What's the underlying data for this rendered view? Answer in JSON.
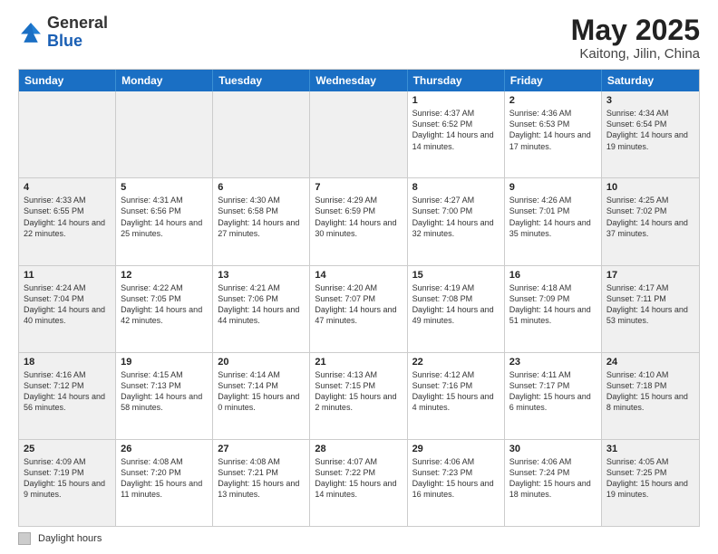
{
  "header": {
    "logo_general": "General",
    "logo_blue": "Blue",
    "title": "May 2025",
    "subtitle": "Kaitong, Jilin, China"
  },
  "calendar": {
    "days_of_week": [
      "Sunday",
      "Monday",
      "Tuesday",
      "Wednesday",
      "Thursday",
      "Friday",
      "Saturday"
    ],
    "rows": [
      [
        {
          "day": "",
          "text": "",
          "shaded": true
        },
        {
          "day": "",
          "text": "",
          "shaded": true
        },
        {
          "day": "",
          "text": "",
          "shaded": true
        },
        {
          "day": "",
          "text": "",
          "shaded": true
        },
        {
          "day": "1",
          "text": "Sunrise: 4:37 AM\nSunset: 6:52 PM\nDaylight: 14 hours and 14 minutes.",
          "shaded": false
        },
        {
          "day": "2",
          "text": "Sunrise: 4:36 AM\nSunset: 6:53 PM\nDaylight: 14 hours and 17 minutes.",
          "shaded": false
        },
        {
          "day": "3",
          "text": "Sunrise: 4:34 AM\nSunset: 6:54 PM\nDaylight: 14 hours and 19 minutes.",
          "shaded": true
        }
      ],
      [
        {
          "day": "4",
          "text": "Sunrise: 4:33 AM\nSunset: 6:55 PM\nDaylight: 14 hours and 22 minutes.",
          "shaded": true
        },
        {
          "day": "5",
          "text": "Sunrise: 4:31 AM\nSunset: 6:56 PM\nDaylight: 14 hours and 25 minutes.",
          "shaded": false
        },
        {
          "day": "6",
          "text": "Sunrise: 4:30 AM\nSunset: 6:58 PM\nDaylight: 14 hours and 27 minutes.",
          "shaded": false
        },
        {
          "day": "7",
          "text": "Sunrise: 4:29 AM\nSunset: 6:59 PM\nDaylight: 14 hours and 30 minutes.",
          "shaded": false
        },
        {
          "day": "8",
          "text": "Sunrise: 4:27 AM\nSunset: 7:00 PM\nDaylight: 14 hours and 32 minutes.",
          "shaded": false
        },
        {
          "day": "9",
          "text": "Sunrise: 4:26 AM\nSunset: 7:01 PM\nDaylight: 14 hours and 35 minutes.",
          "shaded": false
        },
        {
          "day": "10",
          "text": "Sunrise: 4:25 AM\nSunset: 7:02 PM\nDaylight: 14 hours and 37 minutes.",
          "shaded": true
        }
      ],
      [
        {
          "day": "11",
          "text": "Sunrise: 4:24 AM\nSunset: 7:04 PM\nDaylight: 14 hours and 40 minutes.",
          "shaded": true
        },
        {
          "day": "12",
          "text": "Sunrise: 4:22 AM\nSunset: 7:05 PM\nDaylight: 14 hours and 42 minutes.",
          "shaded": false
        },
        {
          "day": "13",
          "text": "Sunrise: 4:21 AM\nSunset: 7:06 PM\nDaylight: 14 hours and 44 minutes.",
          "shaded": false
        },
        {
          "day": "14",
          "text": "Sunrise: 4:20 AM\nSunset: 7:07 PM\nDaylight: 14 hours and 47 minutes.",
          "shaded": false
        },
        {
          "day": "15",
          "text": "Sunrise: 4:19 AM\nSunset: 7:08 PM\nDaylight: 14 hours and 49 minutes.",
          "shaded": false
        },
        {
          "day": "16",
          "text": "Sunrise: 4:18 AM\nSunset: 7:09 PM\nDaylight: 14 hours and 51 minutes.",
          "shaded": false
        },
        {
          "day": "17",
          "text": "Sunrise: 4:17 AM\nSunset: 7:11 PM\nDaylight: 14 hours and 53 minutes.",
          "shaded": true
        }
      ],
      [
        {
          "day": "18",
          "text": "Sunrise: 4:16 AM\nSunset: 7:12 PM\nDaylight: 14 hours and 56 minutes.",
          "shaded": true
        },
        {
          "day": "19",
          "text": "Sunrise: 4:15 AM\nSunset: 7:13 PM\nDaylight: 14 hours and 58 minutes.",
          "shaded": false
        },
        {
          "day": "20",
          "text": "Sunrise: 4:14 AM\nSunset: 7:14 PM\nDaylight: 15 hours and 0 minutes.",
          "shaded": false
        },
        {
          "day": "21",
          "text": "Sunrise: 4:13 AM\nSunset: 7:15 PM\nDaylight: 15 hours and 2 minutes.",
          "shaded": false
        },
        {
          "day": "22",
          "text": "Sunrise: 4:12 AM\nSunset: 7:16 PM\nDaylight: 15 hours and 4 minutes.",
          "shaded": false
        },
        {
          "day": "23",
          "text": "Sunrise: 4:11 AM\nSunset: 7:17 PM\nDaylight: 15 hours and 6 minutes.",
          "shaded": false
        },
        {
          "day": "24",
          "text": "Sunrise: 4:10 AM\nSunset: 7:18 PM\nDaylight: 15 hours and 8 minutes.",
          "shaded": true
        }
      ],
      [
        {
          "day": "25",
          "text": "Sunrise: 4:09 AM\nSunset: 7:19 PM\nDaylight: 15 hours and 9 minutes.",
          "shaded": true
        },
        {
          "day": "26",
          "text": "Sunrise: 4:08 AM\nSunset: 7:20 PM\nDaylight: 15 hours and 11 minutes.",
          "shaded": false
        },
        {
          "day": "27",
          "text": "Sunrise: 4:08 AM\nSunset: 7:21 PM\nDaylight: 15 hours and 13 minutes.",
          "shaded": false
        },
        {
          "day": "28",
          "text": "Sunrise: 4:07 AM\nSunset: 7:22 PM\nDaylight: 15 hours and 14 minutes.",
          "shaded": false
        },
        {
          "day": "29",
          "text": "Sunrise: 4:06 AM\nSunset: 7:23 PM\nDaylight: 15 hours and 16 minutes.",
          "shaded": false
        },
        {
          "day": "30",
          "text": "Sunrise: 4:06 AM\nSunset: 7:24 PM\nDaylight: 15 hours and 18 minutes.",
          "shaded": false
        },
        {
          "day": "31",
          "text": "Sunrise: 4:05 AM\nSunset: 7:25 PM\nDaylight: 15 hours and 19 minutes.",
          "shaded": true
        }
      ]
    ]
  },
  "footer": {
    "legend_label": "Daylight hours"
  }
}
